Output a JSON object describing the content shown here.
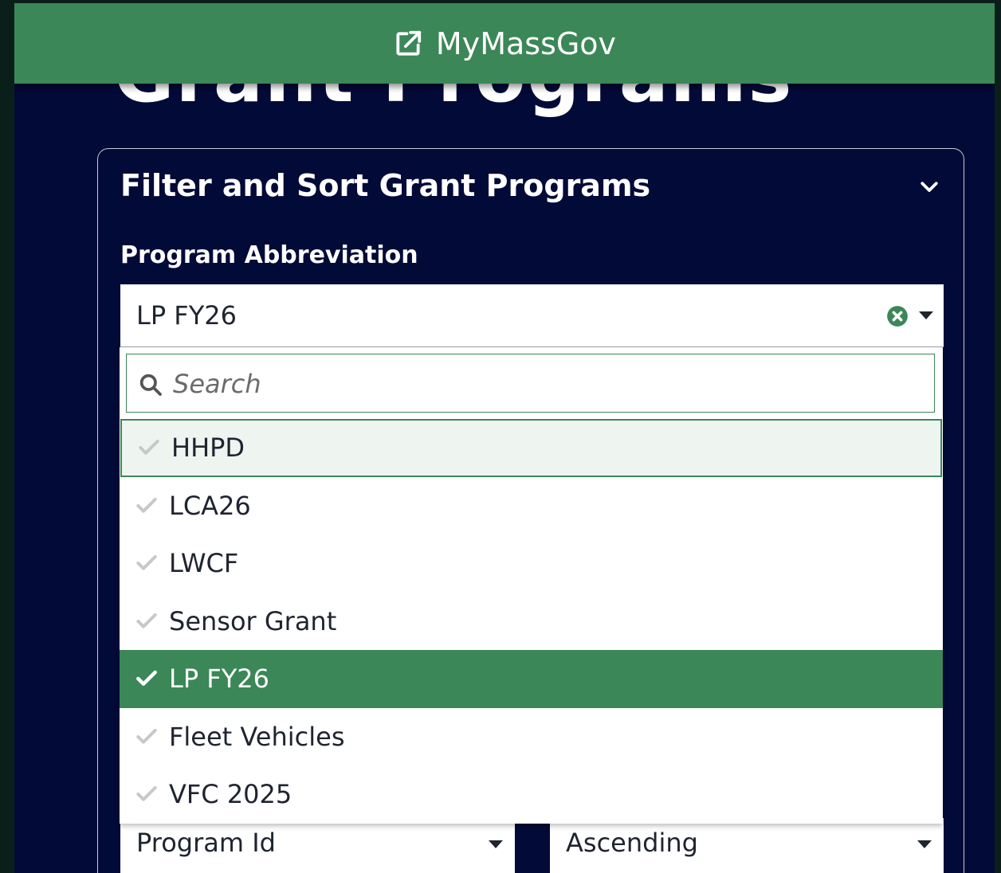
{
  "background_page": {
    "title_partial": "Grant Programs",
    "sort_field_value": "Program Id",
    "sort_order_value": "Ascending"
  },
  "topbar": {
    "link_label": "MyMassGov",
    "icon": "external-link-icon"
  },
  "filter_panel": {
    "title": "Filter and Sort Grant Programs",
    "field_label": "Program Abbreviation",
    "selected_value": "LP FY26",
    "search_placeholder": "Search",
    "options": [
      {
        "label": "HHPD",
        "selected": false,
        "focused": true
      },
      {
        "label": "LCA26",
        "selected": false,
        "focused": false
      },
      {
        "label": "LWCF",
        "selected": false,
        "focused": false
      },
      {
        "label": "Sensor Grant",
        "selected": false,
        "focused": false
      },
      {
        "label": "LP FY26",
        "selected": true,
        "focused": false
      },
      {
        "label": "Fleet Vehicles",
        "selected": false,
        "focused": false
      },
      {
        "label": "VFC 2025",
        "selected": false,
        "focused": false
      }
    ]
  },
  "colors": {
    "brand_green": "#3b8757",
    "page_navy": "#020a38",
    "focus_tint": "#eef4f0",
    "check_grey": "#c8c8c8"
  }
}
